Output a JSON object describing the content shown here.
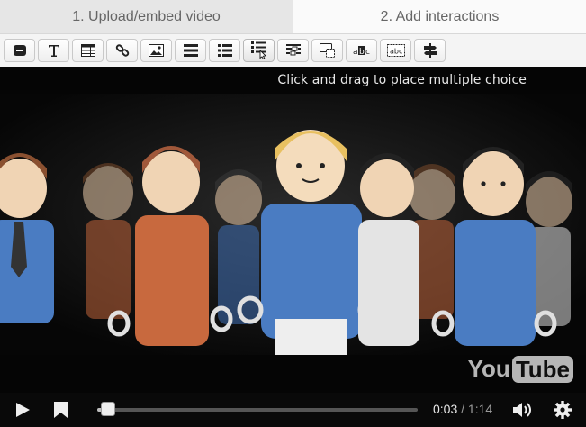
{
  "tabs": [
    {
      "label": "1. Upload/embed video",
      "active": false
    },
    {
      "label": "2. Add interactions",
      "active": true
    }
  ],
  "toolbar": {
    "buttons": [
      {
        "name": "label-icon"
      },
      {
        "name": "text-icon"
      },
      {
        "name": "table-icon"
      },
      {
        "name": "link-icon"
      },
      {
        "name": "image-icon"
      },
      {
        "name": "statements-icon"
      },
      {
        "name": "single-choice-icon"
      },
      {
        "name": "multiple-choice-icon"
      },
      {
        "name": "fill-in-blanks-icon"
      },
      {
        "name": "drag-and-drop-icon"
      },
      {
        "name": "mark-words-icon"
      },
      {
        "name": "drag-text-icon"
      },
      {
        "name": "crossroads-icon"
      }
    ]
  },
  "video": {
    "tooltip": "Click and drag to place multiple choice",
    "logo_you": "You",
    "logo_tube": "Tube",
    "current_time": "0:03",
    "separator": "/",
    "total_time": "1:14",
    "progress_fraction": 0.04
  }
}
